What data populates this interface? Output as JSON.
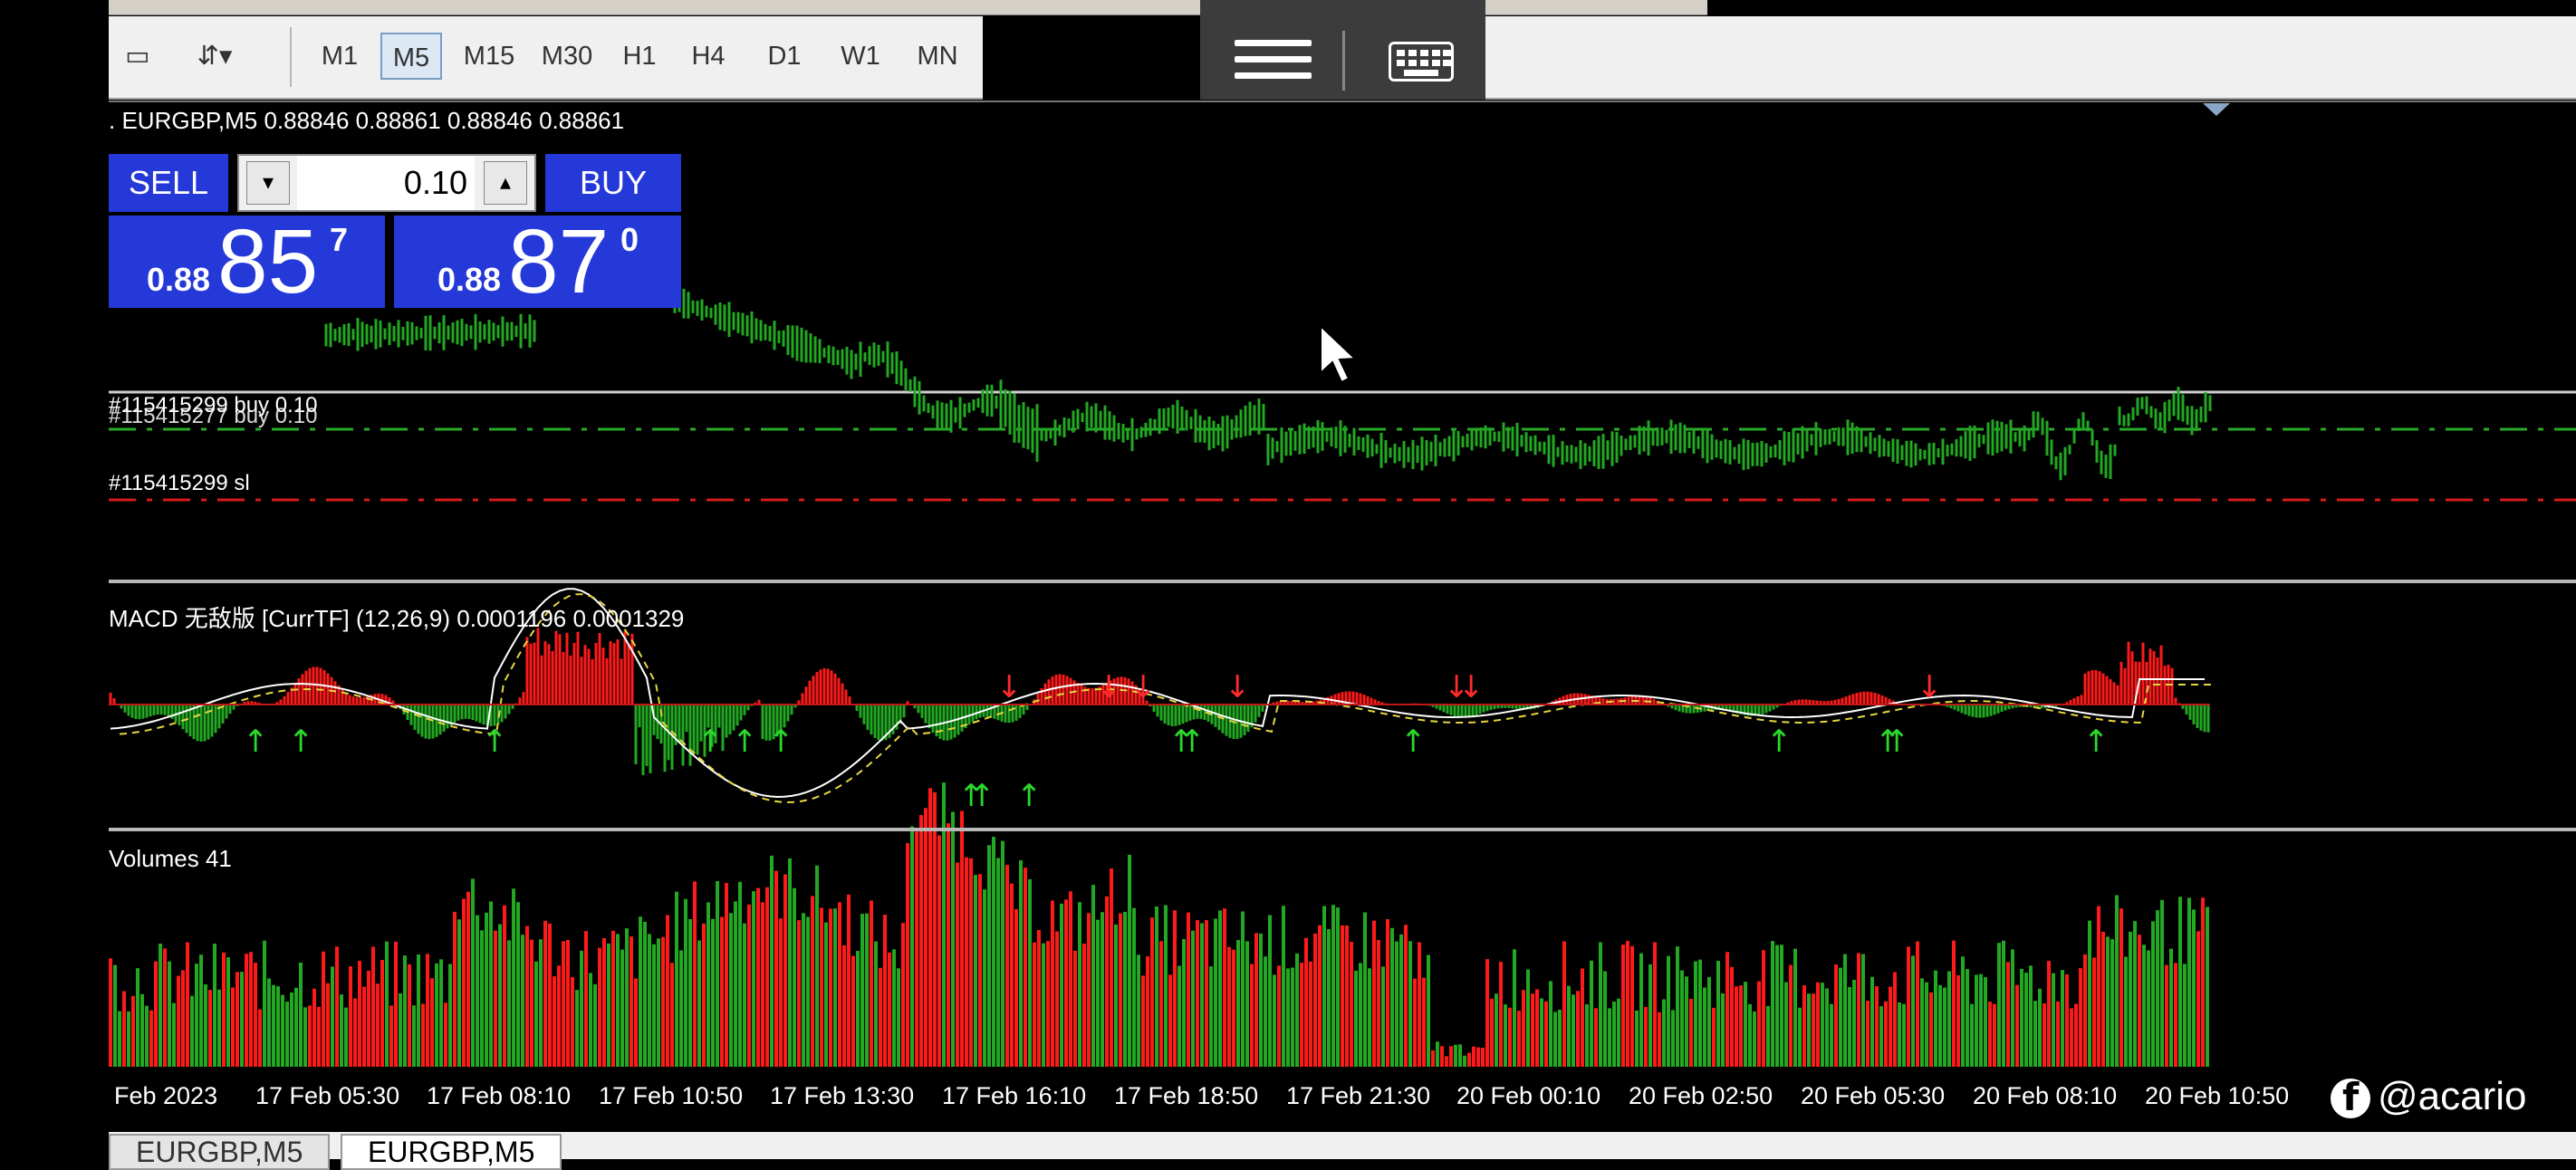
{
  "toolbar": {
    "timeframes": [
      "M1",
      "M5",
      "M15",
      "M30",
      "H1",
      "H4",
      "D1",
      "W1",
      "MN"
    ],
    "active_timeframe": "M5"
  },
  "chart": {
    "header": ". EURGBP,M5  0.88846 0.88861 0.88846 0.88861",
    "order_label_1": "#115415299 buy 0.10",
    "order_label_2": "#115415277 buy 0.10",
    "sl_label": "#115415299 sl"
  },
  "trade_panel": {
    "sell_label": "SELL",
    "buy_label": "BUY",
    "lot": "0.10",
    "sell_price_small": "0.88",
    "sell_price_big": "85",
    "sell_price_sup": "7",
    "buy_price_small": "0.88",
    "buy_price_big": "87",
    "buy_price_sup": "0"
  },
  "macd": {
    "label": "MACD 无敌版 [CurrTF] (12,26,9) 0.0001196 0.0001329"
  },
  "volumes": {
    "label": "Volumes 41"
  },
  "time_axis": [
    "Feb 2023",
    "17 Feb 05:30",
    "17 Feb 08:10",
    "17 Feb 10:50",
    "17 Feb 13:30",
    "17 Feb 16:10",
    "17 Feb 18:50",
    "17 Feb 21:30",
    "20 Feb 00:10",
    "20 Feb 02:50",
    "20 Feb 05:30",
    "20 Feb 08:10",
    "20 Feb 10:50"
  ],
  "tabs": [
    "EURGBP,M5",
    "EURGBP,M5"
  ],
  "watermark": "@acario",
  "colors": {
    "bull": "#22a822",
    "bear": "#ff1a1a",
    "panel_blue": "#2538d8"
  },
  "icons": [
    "menu-icon",
    "keyboard-icon",
    "mouse-cursor-icon",
    "facebook-icon"
  ]
}
